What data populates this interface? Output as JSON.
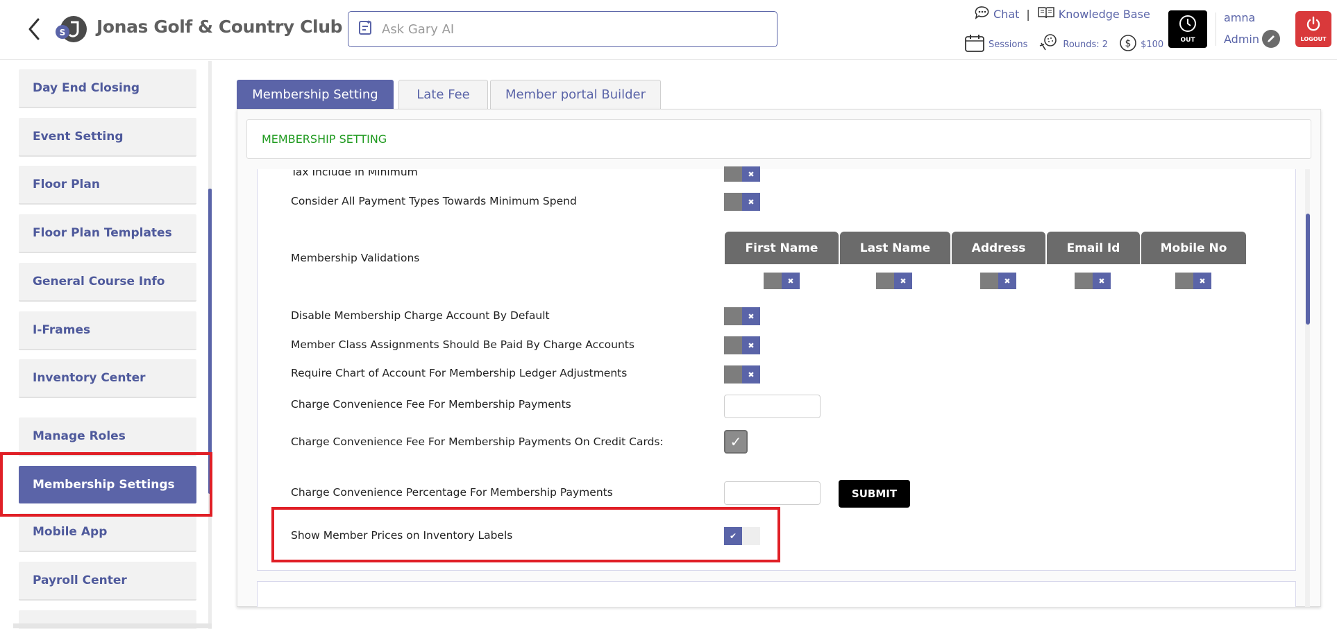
{
  "header": {
    "title": "Jonas Golf & Country Club",
    "logo_badge": "S",
    "ask_placeholder": "Ask Gary AI",
    "chat_label": "Chat",
    "separator": "|",
    "kb_label": "Knowledge Base",
    "sessions_label": "Sessions",
    "rounds_label": "Rounds: 2",
    "balance_label": "$100",
    "out_label": "OUT",
    "user_name": "amna",
    "user_role": "Admin",
    "logout_label": "LOGOUT",
    "brand_color": "#5a64a8",
    "logout_color": "#d9393b"
  },
  "sidebar": {
    "items": [
      {
        "label": "Day End Closing"
      },
      {
        "label": "Event Setting"
      },
      {
        "label": "Floor Plan"
      },
      {
        "label": "Floor Plan Templates"
      },
      {
        "label": "General Course Info"
      },
      {
        "label": "I-Frames"
      },
      {
        "label": "Inventory Center"
      },
      {
        "label": "Manage Roles"
      },
      {
        "label": "Membership Settings",
        "active": true
      },
      {
        "label": "Mobile App"
      },
      {
        "label": "Payroll Center"
      }
    ]
  },
  "tabs": [
    {
      "label": "Membership Setting",
      "active": true
    },
    {
      "label": "Late Fee"
    },
    {
      "label": "Member portal Builder"
    }
  ],
  "section_title": "MEMBERSHIP SETTING",
  "settings": {
    "tax_include": {
      "label": "Tax Include in Minimum",
      "value": "off"
    },
    "consider_all": {
      "label": "Consider All Payment Types Towards Minimum Spend",
      "value": "off"
    },
    "validations": {
      "label": "Membership Validations",
      "columns": [
        "First Name",
        "Last Name",
        "Address",
        "Email Id",
        "Mobile No"
      ]
    },
    "disable_charge": {
      "label": "Disable Membership Charge Account By Default",
      "value": "off"
    },
    "member_class": {
      "label": "Member Class Assignments Should Be Paid By Charge Accounts",
      "value": "off"
    },
    "require_chart": {
      "label": "Require Chart of Account For Membership Ledger Adjustments",
      "value": "off"
    },
    "conv_fee": {
      "label": "Charge Convenience Fee For Membership Payments",
      "value": ""
    },
    "conv_fee_cc": {
      "label": "Charge Convenience Fee For Membership Payments On Credit Cards:",
      "checked": true
    },
    "conv_pct": {
      "label": "Charge Convenience Percentage For Membership Payments",
      "value": ""
    },
    "submit_label": "SUBMIT",
    "show_member_prices": {
      "label": "Show Member Prices on Inventory Labels",
      "value": "on"
    }
  },
  "icons": {
    "off_mark": "✖",
    "on_mark": "✔",
    "check_mark": "✓"
  }
}
